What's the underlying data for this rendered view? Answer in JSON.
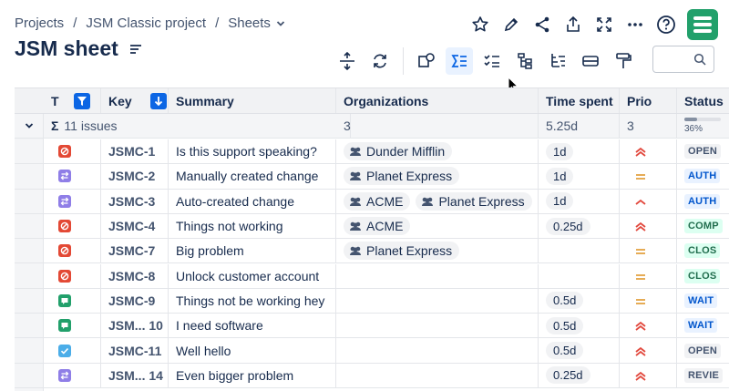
{
  "breadcrumb": {
    "items": [
      "Projects",
      "JSM Classic project",
      "Sheets"
    ],
    "separator": "/"
  },
  "page": {
    "title": "JSM sheet"
  },
  "top_icons": [
    "star-icon",
    "pencil-icon",
    "share-icon",
    "export-icon",
    "fullscreen-icon",
    "more-icon",
    "help-icon"
  ],
  "brand": {
    "color": "#22a06b",
    "accent": "#0c66e4"
  },
  "search": {
    "placeholder": ""
  },
  "grid": {
    "columns": {
      "type": "T",
      "key": "Key",
      "summary": "Summary",
      "organizations": "Organizations",
      "time_spent": "Time spent",
      "priority": "Prio",
      "status": "Status"
    },
    "summary_row": {
      "sigma": "Σ",
      "issue_count": "11 issues",
      "organizations": "3",
      "time_spent": "5.25d",
      "priority": "3",
      "status_progress": 0.36,
      "status_progress_label": "36%"
    },
    "rows": [
      {
        "type": "problem",
        "key": "JSMC-1",
        "summary": "Is this support speaking?",
        "orgs": [
          "Dunder Mifflin"
        ],
        "time": "1d",
        "prio": "highest",
        "status": "OPEN"
      },
      {
        "type": "change",
        "key": "JSMC-2",
        "summary": "Manually created change",
        "orgs": [
          "Planet Express"
        ],
        "time": "1d",
        "prio": "medium",
        "status": "AUTH"
      },
      {
        "type": "change",
        "key": "JSMC-3",
        "summary": "Auto-created change",
        "orgs": [
          "ACME",
          "Planet Express"
        ],
        "time": "1d",
        "prio": "high",
        "status": "AUTH"
      },
      {
        "type": "problem",
        "key": "JSMC-4",
        "summary": "Things not working",
        "orgs": [
          "ACME"
        ],
        "time": "0.25d",
        "prio": "highest",
        "status": "COMP"
      },
      {
        "type": "problem",
        "key": "JSMC-7",
        "summary": "Big problem",
        "orgs": [
          "Planet Express"
        ],
        "time": "",
        "prio": "medium",
        "status": "CLOS"
      },
      {
        "type": "problem",
        "key": "JSMC-8",
        "summary": "Unlock customer account",
        "orgs": [],
        "time": "",
        "prio": "medium",
        "status": "CLOS"
      },
      {
        "type": "question",
        "key": "JSMC-9",
        "summary": "Things not be working hey",
        "orgs": [],
        "time": "0.5d",
        "prio": "medium",
        "status": "WAIT"
      },
      {
        "type": "question",
        "key": "JSM... 10",
        "summary": "I need software",
        "orgs": [],
        "time": "0.5d",
        "prio": "highest",
        "status": "WAIT"
      },
      {
        "type": "task",
        "key": "JSMC-11",
        "summary": "Well hello",
        "orgs": [],
        "time": "0.5d",
        "prio": "highest",
        "status": "OPEN"
      },
      {
        "type": "change",
        "key": "JSM... 14",
        "summary": "Even bigger problem",
        "orgs": [],
        "time": "0.25d",
        "prio": "highest",
        "status": "REVIE"
      }
    ]
  }
}
